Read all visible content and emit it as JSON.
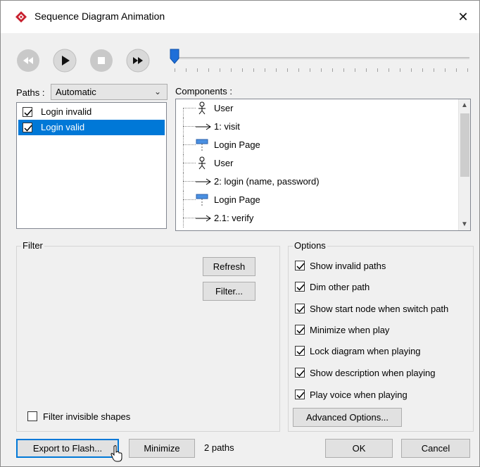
{
  "window": {
    "title": "Sequence Diagram Animation",
    "close_glyph": "✕"
  },
  "playback": {
    "buttons": [
      "rewind",
      "play",
      "stop",
      "fast-forward"
    ],
    "progress": 0
  },
  "paths": {
    "label": "Paths :",
    "selected": "Automatic",
    "items": [
      {
        "label": "Login invalid",
        "checked": true,
        "selected": false
      },
      {
        "label": "Login valid",
        "checked": true,
        "selected": true
      }
    ]
  },
  "components": {
    "label": "Components :",
    "items": [
      {
        "icon": "actor-icon",
        "label": "User"
      },
      {
        "icon": "message-arrow-icon",
        "label": "1: visit"
      },
      {
        "icon": "lifeline-icon",
        "label": "Login Page"
      },
      {
        "icon": "actor-icon",
        "label": "User"
      },
      {
        "icon": "message-arrow-icon",
        "label": "2: login (name, password)"
      },
      {
        "icon": "lifeline-icon",
        "label": "Login Page"
      },
      {
        "icon": "message-arrow-icon",
        "label": "2.1: verify"
      }
    ]
  },
  "filter": {
    "title": "Filter",
    "refresh_label": "Refresh",
    "filter_label": "Filter...",
    "filter_invisible_label": "Filter invisible shapes",
    "filter_invisible_checked": false
  },
  "options": {
    "title": "Options",
    "items": [
      {
        "label": "Show invalid paths",
        "checked": true
      },
      {
        "label": "Dim other path",
        "checked": true
      },
      {
        "label": "Show start node when switch path",
        "checked": true
      },
      {
        "label": "Minimize when play",
        "checked": true
      },
      {
        "label": "Lock diagram when playing",
        "checked": true
      },
      {
        "label": "Show description when playing",
        "checked": true
      },
      {
        "label": "Play voice when playing",
        "checked": true
      }
    ],
    "advanced_label": "Advanced Options..."
  },
  "footer": {
    "export_label": "Export to Flash...",
    "minimize_label": "Minimize",
    "count_text": "2 paths",
    "ok_label": "OK",
    "cancel_label": "Cancel"
  },
  "colors": {
    "accent": "#0078d7",
    "brand": "#c8202e"
  }
}
